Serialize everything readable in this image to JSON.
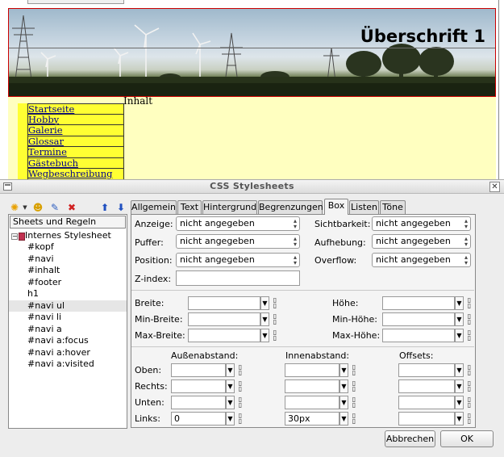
{
  "preview": {
    "heading": "Überschrift 1",
    "content_label": "Inhalt",
    "nav_items": [
      "Startseite",
      "Hobby",
      "Galerie",
      "Glossar",
      "Termine",
      "Gästebuch",
      "Wegbeschreibung"
    ]
  },
  "dialog": {
    "title": "CSS Stylesheets",
    "close_icon": "close-icon",
    "toolbar": {
      "icons": [
        "new-style-icon",
        "dropdown-arrow-icon",
        "open-icon",
        "edit-icon",
        "delete-icon",
        "move-up-icon",
        "move-down-icon"
      ]
    },
    "tree": {
      "header": "Sheets und Regeln",
      "root": "Internes Stylesheet",
      "items": [
        "#kopf",
        "#navi",
        "#inhalt",
        "#footer",
        "h1",
        "#navi ul",
        "#navi li",
        "#navi a",
        "#navi a:focus",
        "#navi a:hover",
        "#navi a:visited"
      ],
      "selected": "#navi ul"
    },
    "tabs": [
      "Allgemein",
      "Text",
      "Hintergrund",
      "Begrenzungen",
      "Box",
      "Listen",
      "Töne"
    ],
    "active_tab": "Box",
    "box": {
      "anzeige_label": "Anzeige:",
      "anzeige_value": "nicht angegeben",
      "sichtbarkeit_label": "Sichtbarkeit:",
      "sichtbarkeit_value": "nicht angegeben",
      "puffer_label": "Puffer:",
      "puffer_value": "nicht angegeben",
      "aufhebung_label": "Aufhebung:",
      "aufhebung_value": "nicht angegeben",
      "position_label": "Position:",
      "position_value": "nicht angegeben",
      "overflow_label": "Overflow:",
      "overflow_value": "nicht angegeben",
      "zindex_label": "Z-index:",
      "zindex_value": "",
      "breite_label": "Breite:",
      "minbreite_label": "Min-Breite:",
      "maxbreite_label": "Max-Breite:",
      "hoehe_label": "Höhe:",
      "minhoehe_label": "Min-Höhe:",
      "maxhoehe_label": "Max-Höhe:",
      "aussen_label": "Außenabstand:",
      "innen_label": "Innenabstand:",
      "offsets_label": "Offsets:",
      "oben_label": "Oben:",
      "rechts_label": "Rechts:",
      "unten_label": "Unten:",
      "links_label": "Links:",
      "links_aussen_value": "0",
      "links_innen_value": "30px"
    },
    "buttons": {
      "cancel": "Abbrechen",
      "ok": "OK"
    }
  }
}
